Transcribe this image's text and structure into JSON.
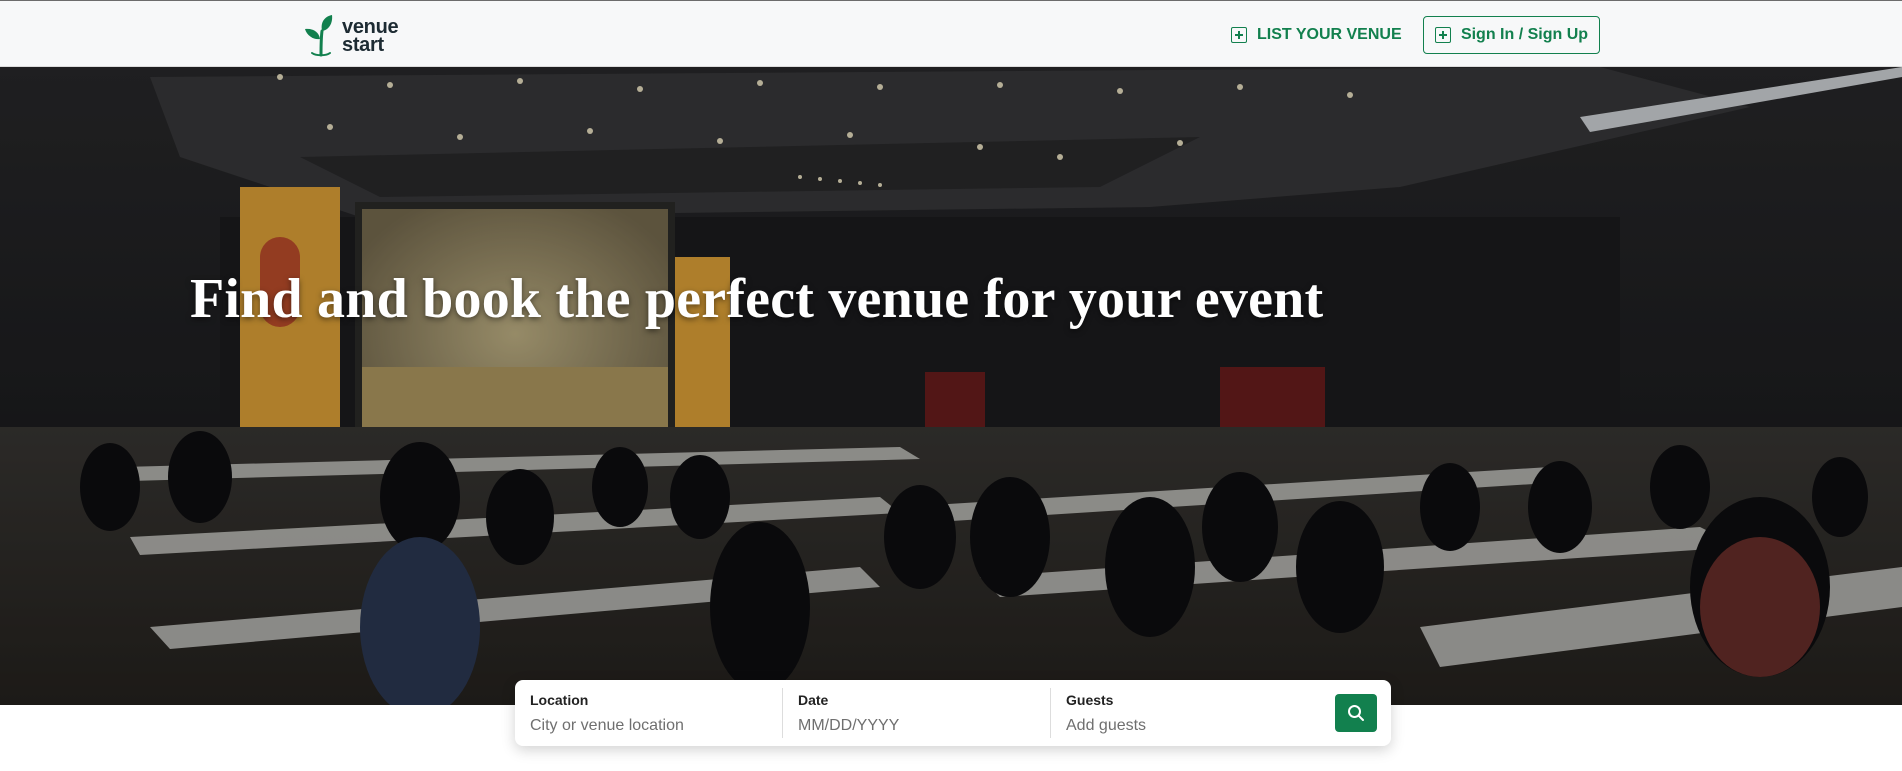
{
  "header": {
    "logo_line1": "venue",
    "logo_line2": "start",
    "list_venue_label": "LIST YOUR VENUE",
    "signin_label": "Sign In / Sign Up"
  },
  "hero": {
    "title": "Find and book the perfect venue for your event"
  },
  "search": {
    "location_label": "Location",
    "location_placeholder": "City or venue location",
    "date_label": "Date",
    "date_placeholder": "MM/DD/YYYY",
    "guests_label": "Guests",
    "guests_placeholder": "Add guests"
  },
  "colors": {
    "brand_green": "#12804e",
    "header_bg": "#f7f8f9",
    "hero_overlay": "#15171a"
  },
  "icons": {
    "logo": "sprout-icon",
    "list_venue": "plus-square-icon",
    "signin": "plus-square-icon",
    "search_button": "search-icon"
  }
}
